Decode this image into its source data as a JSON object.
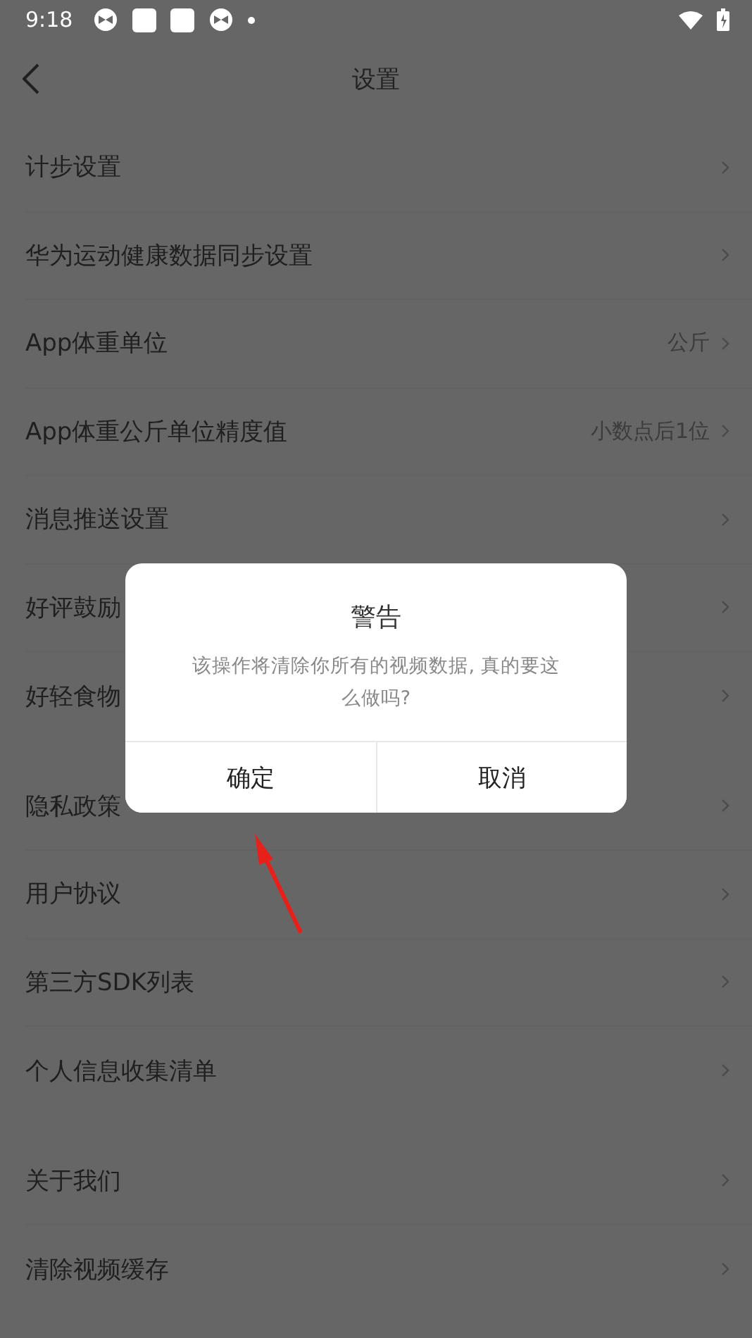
{
  "status_bar": {
    "time": "9:18"
  },
  "nav": {
    "title": "设置"
  },
  "groups": [
    {
      "items": [
        {
          "label": "计步设置"
        },
        {
          "label": "华为运动健康数据同步设置"
        },
        {
          "label": "App体重单位",
          "value": "公斤"
        },
        {
          "label": "App体重公斤单位精度值",
          "value": "小数点后1位"
        },
        {
          "label": "消息推送设置"
        },
        {
          "label": "好评鼓励"
        },
        {
          "label": "好轻食物"
        }
      ]
    },
    {
      "items": [
        {
          "label": "隐私政策"
        },
        {
          "label": "用户协议"
        },
        {
          "label": "第三方SDK列表"
        },
        {
          "label": "个人信息收集清单"
        }
      ]
    },
    {
      "items": [
        {
          "label": "关于我们"
        },
        {
          "label": "清除视频缓存"
        }
      ]
    }
  ],
  "dialog": {
    "title": "警告",
    "message": "该操作将清除你所有的视频数据, 真的要这么做吗?",
    "buttons": [
      "确定",
      "取消"
    ]
  }
}
